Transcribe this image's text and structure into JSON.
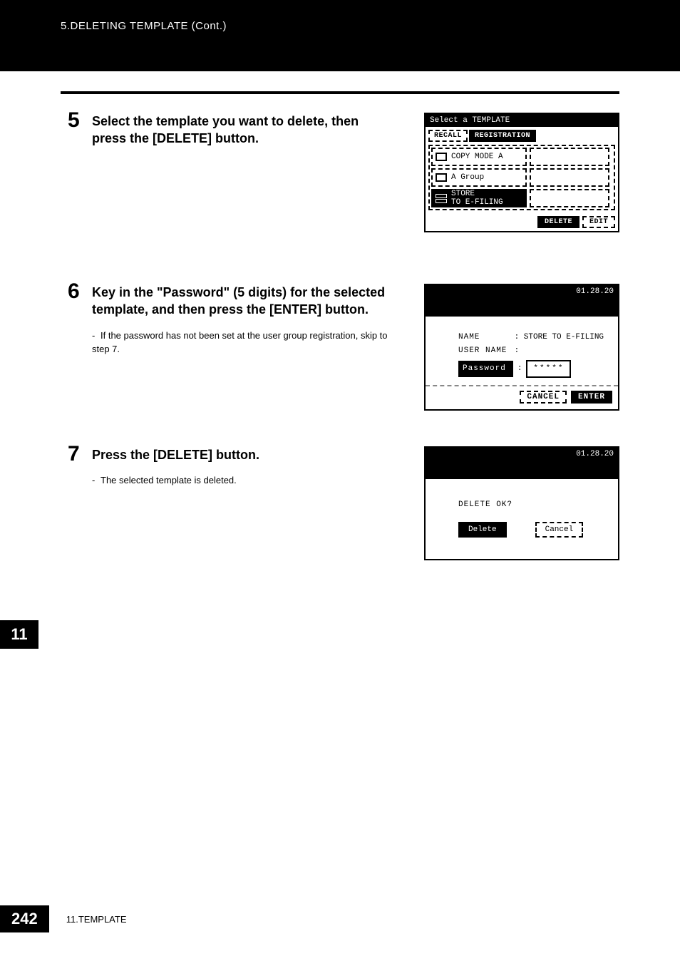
{
  "header": {
    "crumb": "5.DELETING TEMPLATE (Cont.)"
  },
  "steps": {
    "s5": {
      "num": "5",
      "title": "Select the template you want to delete, then press the [DELETE] button."
    },
    "s6": {
      "num": "6",
      "title": "Key in the \"Password\" (5 digits) for the selected template, and then press the [ENTER] button.",
      "sub": "If the password has not been set at the user group registration, skip to step 7."
    },
    "s7": {
      "num": "7",
      "title": "Press the [DELETE] button.",
      "sub": "The selected template is deleted."
    }
  },
  "screen1": {
    "title": "Select a TEMPLATE",
    "tabs": {
      "recall": "RECALL",
      "reg": "REGISTRATION"
    },
    "rows": [
      {
        "label": "COPY MODE A"
      },
      {
        "label": "A Group"
      },
      {
        "label_l1": "STORE",
        "label_l2": "TO E-FILING"
      }
    ],
    "buttons": {
      "delete": "DELETE",
      "edit": "EDIT"
    }
  },
  "screen2": {
    "date": "01.28.20",
    "name_lbl": "NAME",
    "name_val": ": STORE TO E-FILING",
    "user_lbl": "USER NAME",
    "user_val": ":",
    "pw_lbl": "Password",
    "pw_colon": ":",
    "pw_val": "*****",
    "cancel": "CANCEL",
    "enter": "ENTER"
  },
  "screen3": {
    "date": "01.28.20",
    "question": "DELETE OK?",
    "delete": "Delete",
    "cancel": "Cancel"
  },
  "side_tab": "11",
  "footer": {
    "page": "242",
    "chapter": "11.TEMPLATE"
  }
}
